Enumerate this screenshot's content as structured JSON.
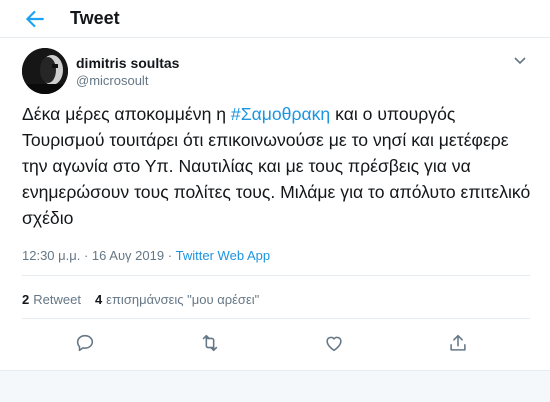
{
  "header": {
    "title": "Tweet",
    "back_icon": "arrow-left-icon"
  },
  "user": {
    "name": "dimitris soultas",
    "handle": "@microsoult"
  },
  "tweet": {
    "before": "Δέκα μέρες αποκομμένη η ",
    "hashtag": "#Σαμοθρακη",
    "after": " και ο υπουργός Τουρισμού τουιτάρει ότι επικοινωνούσε με το νησί και μετέφερε την αγωνία στο Υπ. Ναυτιλίας και με τους πρέσβεις για να ενημερώσουν τους πολίτες τους. Μιλάμε για το απόλυτο επιτελικό σχέδιο"
  },
  "meta": {
    "time": "12:30 μ.μ.",
    "sep": " · ",
    "date": "16 Αυγ 2019",
    "source": "Twitter Web App"
  },
  "stats": {
    "retweets": "2",
    "retweets_label": "Retweet",
    "likes": "4",
    "likes_label": "επισημάνσεις \"μου αρέσει\""
  },
  "actions": [
    "reply-icon",
    "retweet-icon",
    "like-icon",
    "share-icon"
  ],
  "colors": {
    "accent": "#1da1f2",
    "link": "#1b95e0",
    "muted": "#657786"
  }
}
